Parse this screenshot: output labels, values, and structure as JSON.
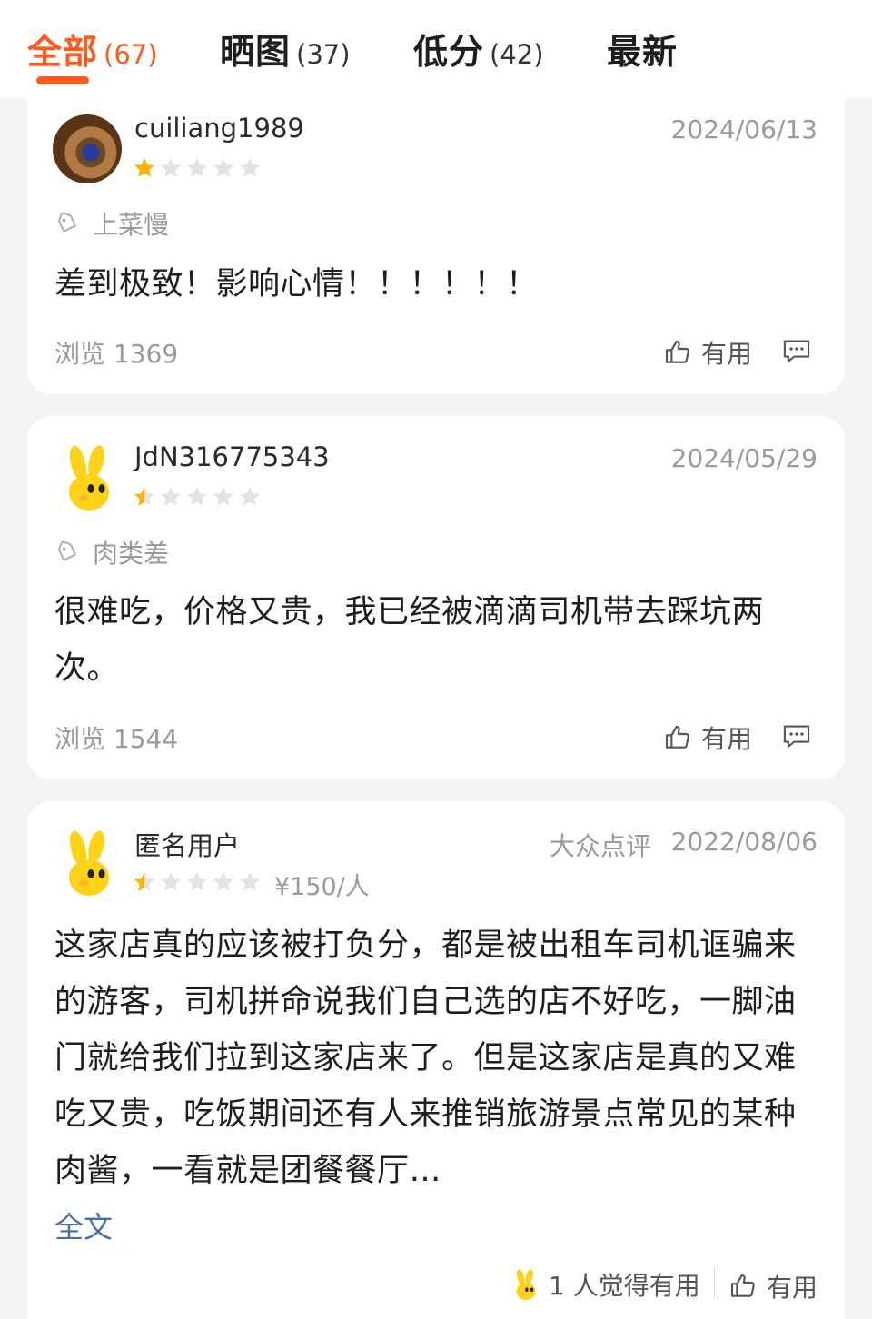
{
  "colors": {
    "accent": "#ff5a1f",
    "star_filled": "#ffb400",
    "star_empty": "#e3e3e3",
    "link": "#4a6fa5"
  },
  "tabs": [
    {
      "label": "全部",
      "count": "(67)",
      "active": true
    },
    {
      "label": "晒图",
      "count": "(37)"
    },
    {
      "label": "低分",
      "count": "(42)"
    },
    {
      "label": "最新",
      "count": ""
    }
  ],
  "reviews": [
    {
      "username": "cuiliang1989",
      "avatar_icon": "photo-avatar",
      "date": "2024/06/13",
      "rating": 1,
      "tag": "上菜慢",
      "content": "差到极致！影响心情！！！！！！",
      "views": "浏览 1369",
      "useful_label": "有用"
    },
    {
      "username": "JdN316775343",
      "avatar_icon": "yellow-mascot-avatar",
      "date": "2024/05/29",
      "rating": 0.5,
      "tag": "肉类差",
      "content": "很难吃，价格又贵，我已经被滴滴司机带去踩坑两次。",
      "views": "浏览 1544",
      "useful_label": "有用"
    },
    {
      "username": "匿名用户",
      "avatar_icon": "yellow-mascot-avatar",
      "source": "大众点评",
      "date": "2022/08/06",
      "rating": 0.5,
      "price": "¥150/人",
      "content": "这家店真的应该被打负分，都是被出租车司机诓骗来的游客，司机拼命说我们自己选的店不好吃，一脚油门就给我们拉到这家店来了。但是这家店是真的又难吃又贵，吃饭期间还有人来推销旅游景点常见的某种肉酱，一看就是团餐餐厅…",
      "full_text_link": "全文",
      "helpful_text": "1 人觉得有用",
      "useful_label": "有用"
    }
  ]
}
